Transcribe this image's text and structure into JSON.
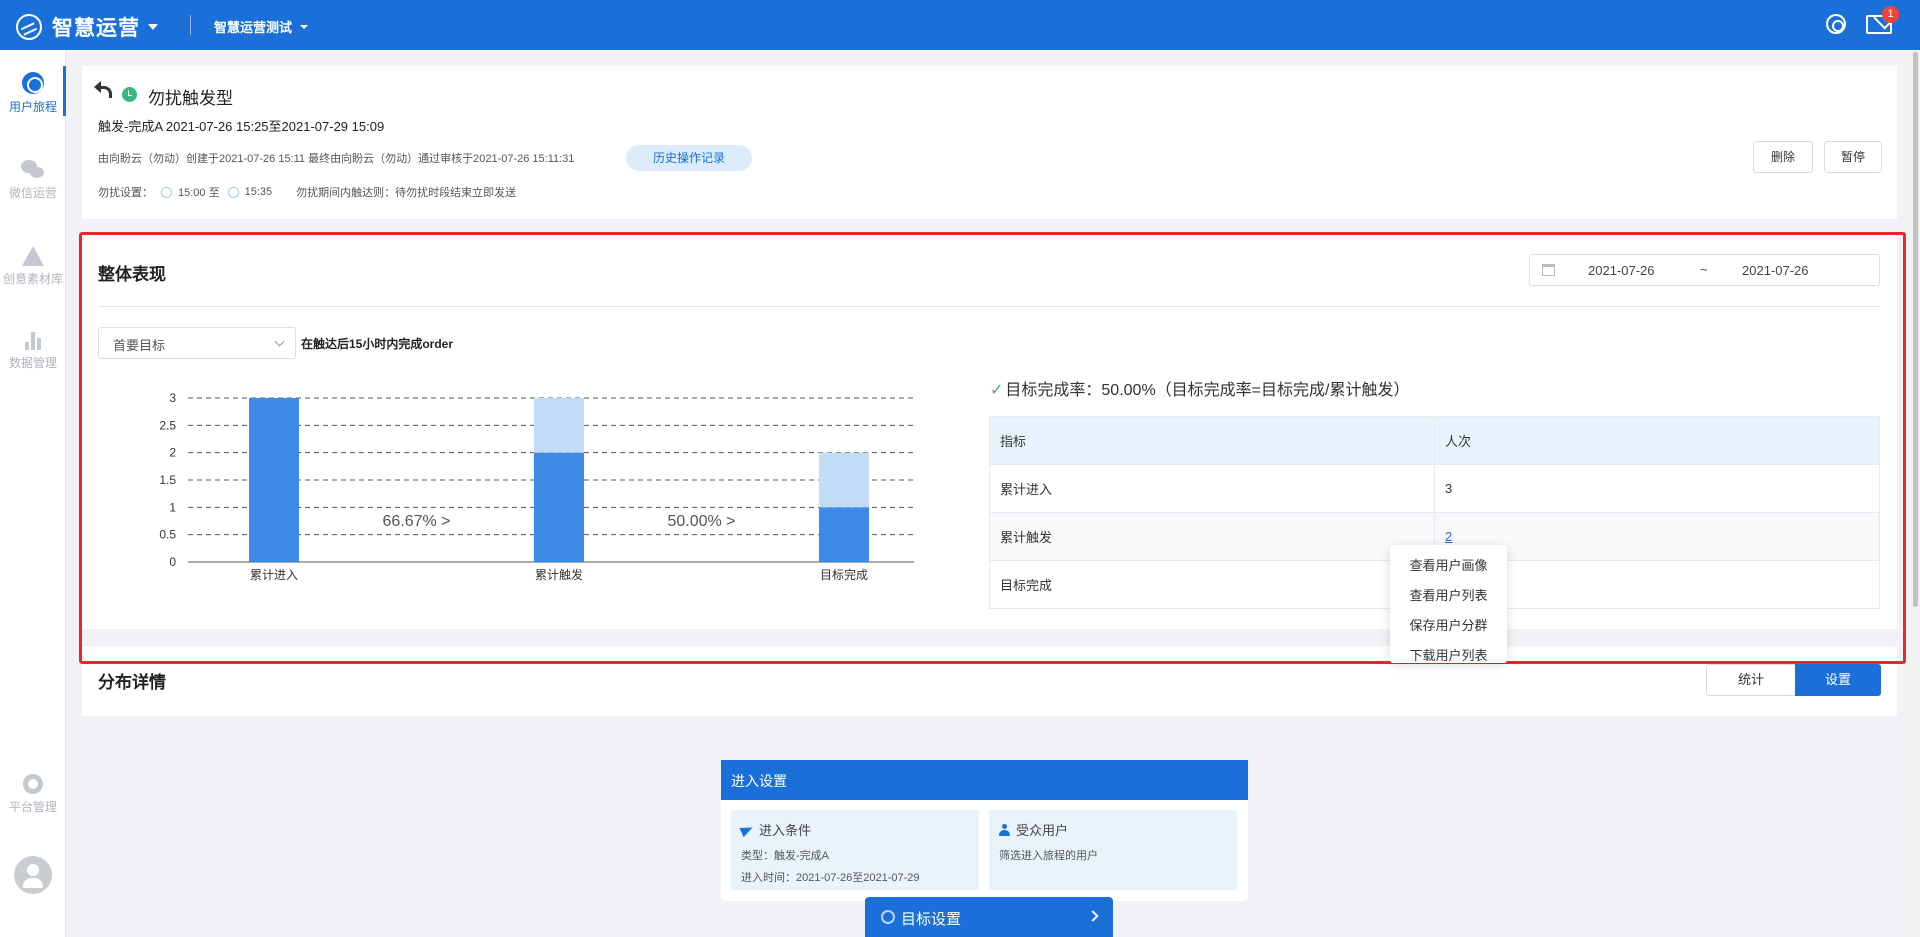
{
  "topbar": {
    "brand": "智慧运营",
    "project": "智慧运营测试",
    "notification_count": "1",
    "icons": [
      "logo-icon",
      "help-icon",
      "mail-icon"
    ]
  },
  "sidebar": {
    "items": [
      {
        "label": "用户旅程",
        "icon": "journey-icon",
        "active": true
      },
      {
        "label": "微信运营",
        "icon": "wechat-icon"
      },
      {
        "label": "创意素材库",
        "icon": "creative-icon"
      },
      {
        "label": "数据管理",
        "icon": "data-icon"
      },
      {
        "label": "平台管理",
        "icon": "gear-icon"
      }
    ]
  },
  "header": {
    "title": "勿扰触发型",
    "subtitle": "触发-完成A 2021-07-26 15:25至2021-07-29 15:09",
    "meta": "由向盼云（勿动）创建于2021-07-26 15:11 最终由向盼云（勿动）通过审核于2021-07-26 15:11:31",
    "history_button": "历史操作记录",
    "disturb_label": "勿扰设置：",
    "disturb_start": "15:00 至",
    "disturb_end": "15:35",
    "disturb_rule": "勿扰期间内触达则：待勿扰时段结束立即发送",
    "delete_button": "删除",
    "pause_button": "暂停"
  },
  "performance": {
    "title": "整体表现",
    "date_start": "2021-07-26",
    "date_sep": "~",
    "date_end": "2021-07-26",
    "goal_select": "首要目标",
    "goal_desc": "在触达后15小时内完成order",
    "rate_text": "目标完成率：50.00%（目标完成率=目标完成/累计触发）",
    "table": {
      "headers": [
        "指标",
        "人次"
      ],
      "rows": [
        {
          "metric": "累计进入",
          "count": "3"
        },
        {
          "metric": "累计触发",
          "count": "2"
        },
        {
          "metric": "目标完成",
          "count": ""
        }
      ]
    }
  },
  "chart_data": {
    "type": "bar",
    "categories": [
      "累计进入",
      "累计触发",
      "目标完成"
    ],
    "series": [
      {
        "values": [
          3,
          2,
          1
        ],
        "color": "#3d8ae6"
      },
      {
        "values": [
          0,
          1,
          1
        ],
        "color": "#c3dcf7"
      }
    ],
    "conversions": [
      "66.67% >",
      "50.00% >"
    ],
    "yticks": [
      "0",
      "0.5",
      "1",
      "1.5",
      "2",
      "2.5",
      "3"
    ],
    "ylim": [
      0,
      3
    ],
    "grid": true,
    "stacked": true
  },
  "context_menu": {
    "items": [
      "查看用户画像",
      "查看用户列表",
      "保存用户分群",
      "下载用户列表"
    ]
  },
  "distribution": {
    "title": "分布详情",
    "stat_button": "统计",
    "settings_button": "设置"
  },
  "entry": {
    "header": "进入设置",
    "condition_title": "进入条件",
    "condition_type": "类型：触发-完成A",
    "condition_time": "进入时间：2021-07-26至2021-07-29",
    "audience_title": "受众用户",
    "audience_desc": "筛选进入旅程的用户"
  },
  "goal_setting": {
    "label": "目标设置"
  },
  "colors": {
    "primary": "#1a6fd8",
    "bar_dark": "#3d8ae6",
    "bar_light": "#c3dcf7",
    "highlight": "#e8272a",
    "success": "#3ab780"
  }
}
